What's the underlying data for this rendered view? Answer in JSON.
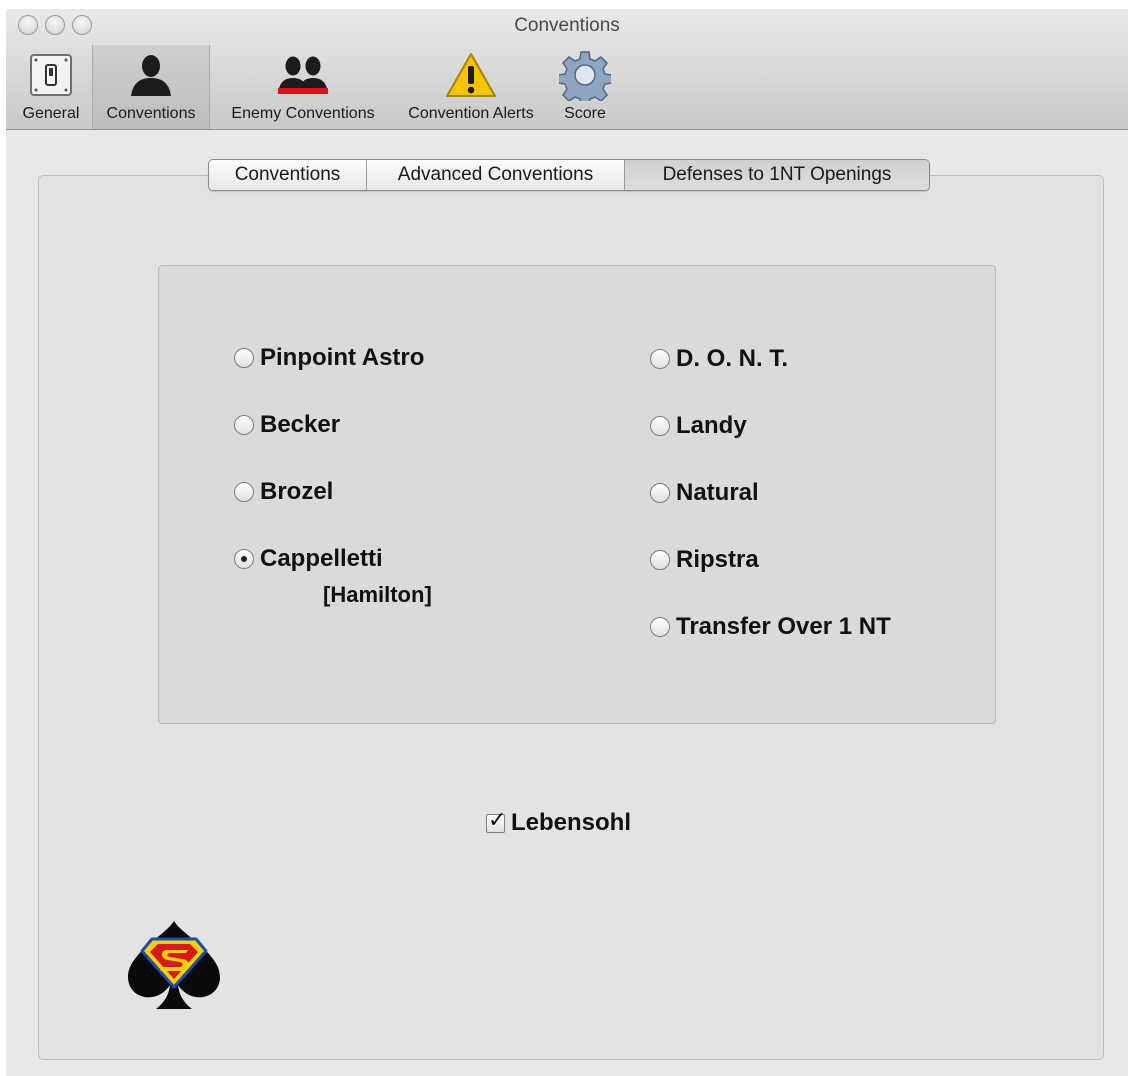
{
  "window": {
    "title": "Conventions"
  },
  "toolbar": {
    "items": [
      {
        "label": "General",
        "icon": "switch-icon"
      },
      {
        "label": "Conventions",
        "icon": "person-icon",
        "selected": true
      },
      {
        "label": "Enemy Conventions",
        "icon": "two-people-icon"
      },
      {
        "label": "Convention Alerts",
        "icon": "warning-icon"
      },
      {
        "label": "Score",
        "icon": "gear-icon"
      }
    ]
  },
  "tabs": [
    {
      "label": "Conventions"
    },
    {
      "label": "Advanced Conventions"
    },
    {
      "label": "Defenses to 1NT Openings",
      "selected": true
    }
  ],
  "options": {
    "left": [
      {
        "label": "Pinpoint Astro",
        "checked": false
      },
      {
        "label": "Becker",
        "checked": false
      },
      {
        "label": "Brozel",
        "checked": false
      },
      {
        "label": "Cappelletti",
        "checked": true,
        "sublabel": "[Hamilton]"
      }
    ],
    "right": [
      {
        "label": "D. O. N. T.",
        "checked": false
      },
      {
        "label": "Landy",
        "checked": false
      },
      {
        "label": "Natural",
        "checked": false
      },
      {
        "label": "Ripstra",
        "checked": false
      },
      {
        "label": "Transfer Over 1 NT",
        "checked": false
      }
    ]
  },
  "lebensohl": {
    "label": "Lebensohl",
    "checked": true
  },
  "colors": {
    "warning": "#f5c400",
    "enemy_red": "#d8141a",
    "superman_red": "#d7191c",
    "superman_yellow": "#f6d000",
    "superman_blue": "#1b4fb2"
  }
}
